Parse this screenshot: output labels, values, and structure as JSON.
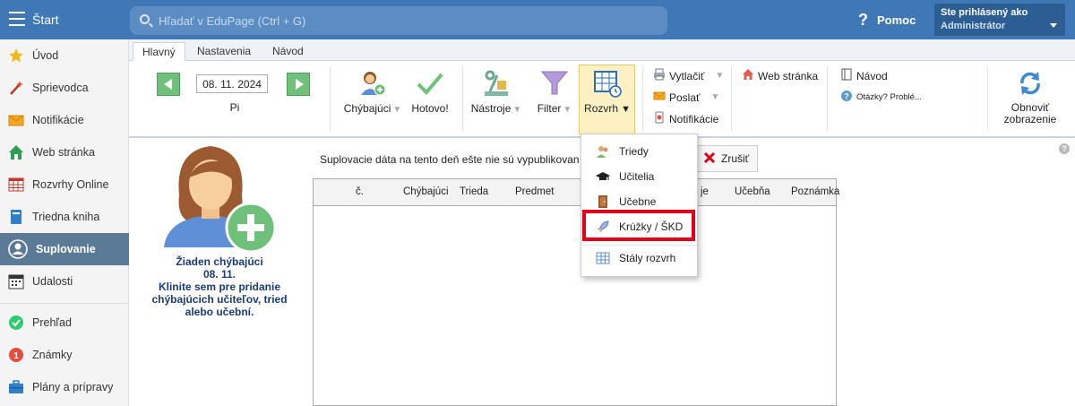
{
  "topbar": {
    "start_label": "Štart",
    "search_placeholder": "Hľadať v EduPage (Ctrl + G)",
    "help_label": "Pomoc",
    "account_line1": "Ste prihlásený ako",
    "account_line2": "Administrátor"
  },
  "sidebar": {
    "items": [
      {
        "label": "Úvod",
        "icon": "star-icon"
      },
      {
        "label": "Sprievodca",
        "icon": "magic-wand-icon"
      },
      {
        "label": "Notifikácie",
        "icon": "envelope-icon"
      },
      {
        "label": "Web stránka",
        "icon": "house-icon"
      },
      {
        "label": "Rozvrhy Online",
        "icon": "timetable-icon"
      },
      {
        "label": "Triedna kniha",
        "icon": "book-icon"
      },
      {
        "label": "Suplovanie",
        "icon": "person-icon"
      },
      {
        "label": "Udalosti",
        "icon": "calendar-icon"
      },
      {
        "label": "Prehľad",
        "icon": "check-circle-icon"
      },
      {
        "label": "Známky",
        "icon": "grades-icon"
      },
      {
        "label": "Plány a prípravy",
        "icon": "briefcase-icon"
      }
    ],
    "active_index": 6
  },
  "tabs": [
    "Hlavný",
    "Nastavenia",
    "Návod"
  ],
  "ribbon": {
    "date": "08. 11. 2024",
    "day": "Pi",
    "chybajuci": "Chýbajúci",
    "hotovo": "Hotovo!",
    "nastroje": "Nástroje",
    "filter": "Filter",
    "rozvrh": "Rozvrh",
    "vytlacit": "Vytlačiť",
    "poslat": "Poslať",
    "notifikacie": "Notifikácie",
    "web_stranka": "Web stránka",
    "navod": "Návod",
    "otazky": "Otázky? Problé...",
    "obnovit_line1": "Obnoviť",
    "obnovit_line2": "zobrazenie"
  },
  "content": {
    "avatar_line1": "Žiaden chýbajúci",
    "avatar_line2": "08. 11.",
    "avatar_line3": "Klinite sem pre pridanie",
    "avatar_line4": "chýbajúcich učiteľov, tried",
    "avatar_line5": "alebo učební.",
    "notice": "Suplovacie dáta na tento deň ešte nie sú vypublikovan",
    "cancel_label": "Zrušiť",
    "table_headers": [
      "č.",
      "Chýbajúci",
      "Trieda",
      "Predmet",
      "je",
      "Učebňa",
      "Poznámka"
    ]
  },
  "dropdown": {
    "items": [
      "Triedy",
      "Učitelia",
      "Učebne",
      "Krúžky / ŠKD",
      "Stály rozvrh"
    ],
    "highlighted_index": 3
  },
  "colors": {
    "topbar": "#3f78b5",
    "active_sidebar": "#5a7a96",
    "highlight": "#e3001b",
    "avatar_text": "#1a3a7c"
  }
}
